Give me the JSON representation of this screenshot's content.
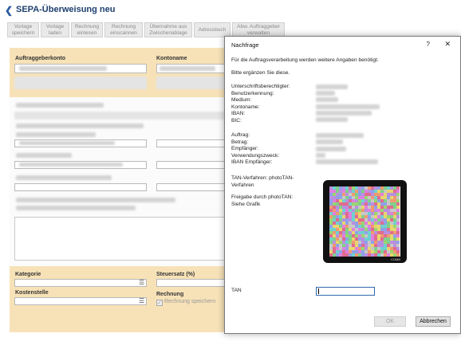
{
  "header": {
    "title": "SEPA-Überweisung neu",
    "back_icon": "arrow-left-icon"
  },
  "toolbar": [
    {
      "line1": "Vorlage",
      "line2": "speichern"
    },
    {
      "line1": "Vorlage",
      "line2": "laden"
    },
    {
      "line1": "Rechnung",
      "line2": "einlesen"
    },
    {
      "line1": "Rechnung",
      "line2": "einscannen"
    },
    {
      "line1": "Übernahme aus",
      "line2": "Zwischenablage"
    },
    {
      "line1": "Adressbuch",
      "line2": ""
    },
    {
      "line1": "Abw. Auftraggeber",
      "line2": "verwalten"
    }
  ],
  "form": {
    "account_label": "Auftraggeberkonto",
    "account_name_label": "Kontoname",
    "category_label": "Kategorie",
    "tax_label": "Steuersatz (%)",
    "cost_center_label": "Kostenstelle",
    "invoice_label": "Rechnung",
    "save_invoice_label": "Rechnung speichern",
    "colors": {
      "panel": "#f7e2b8",
      "accent": "#1d3f6e"
    }
  },
  "dialog": {
    "title": "Nachfrage",
    "help_icon": "?",
    "close_icon": "✕",
    "intro": "Für die Auftragsverarbeitung werden weitere Angaben benötigt.",
    "prompt": "Bitte ergänzen Sie diese.",
    "account_keys": [
      "Unterschriftsberechtigter:",
      "Benutzerkennung:",
      "Medium:",
      "Kontoname:",
      "IBAN:",
      "BIC:"
    ],
    "order_keys": [
      "Auftrag:",
      "Betrag:",
      "Empfänger:",
      "Verwendungszweck:",
      "IBAN Empfänger:"
    ],
    "tan_method": [
      "TAN-Verfahren: photoTAN-",
      "Verfahren"
    ],
    "release": [
      "Freigabe durch photoTAN:",
      "Siehe Grafik"
    ],
    "qr_caption": "COMB",
    "tan_label": "TAN",
    "tan_value": "",
    "ok_label": "OK",
    "cancel_label": "Abbrechen"
  }
}
